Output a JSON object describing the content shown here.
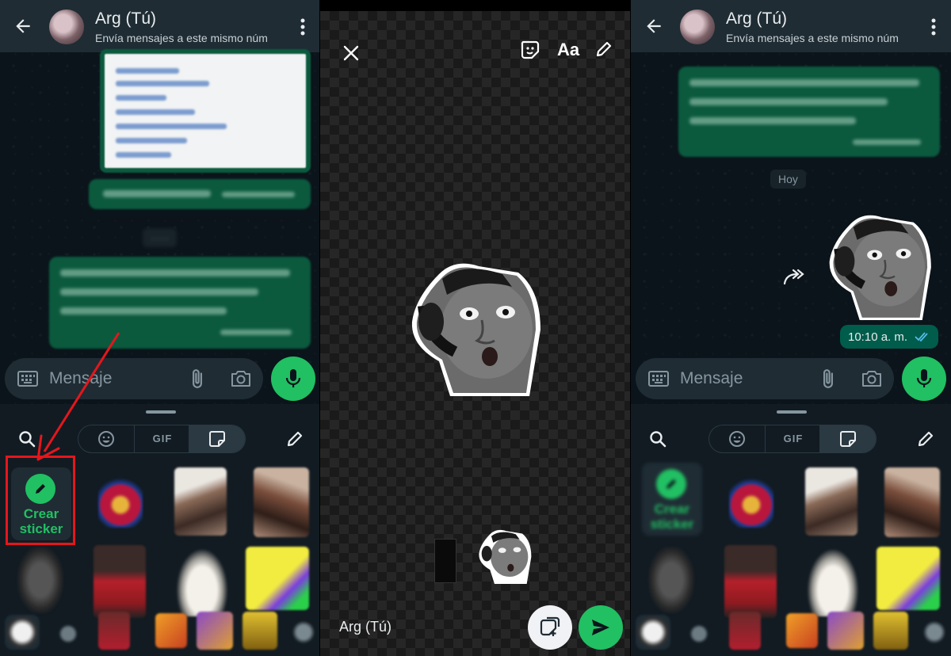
{
  "chat": {
    "contact_name": "Arg (Tú)",
    "contact_subtitle": "Envía mensajes a este mismo núm",
    "input_placeholder": "Mensaje",
    "day_today": "Hoy",
    "message_time": "10:10 a. m."
  },
  "tray": {
    "gif_label": "GIF",
    "create_sticker_label_1": "Crear",
    "create_sticker_label_2": "sticker"
  },
  "editor": {
    "text_tool_label": "Aa",
    "recipient_label": "Arg (Tú)"
  },
  "colors": {
    "accent_green": "#21c063",
    "bubble_green": "#005c4b",
    "header_bg": "#1f2c34",
    "highlight_red": "#e5161c"
  },
  "icons": [
    "back-arrow-icon",
    "kebab-menu-icon",
    "keyboard-icon",
    "paperclip-icon",
    "camera-icon",
    "microphone-icon",
    "search-icon",
    "emoji-icon",
    "sticker-icon",
    "pencil-icon",
    "close-icon",
    "send-icon",
    "forward-icon",
    "double-check-icon",
    "add-sticker-icon"
  ]
}
